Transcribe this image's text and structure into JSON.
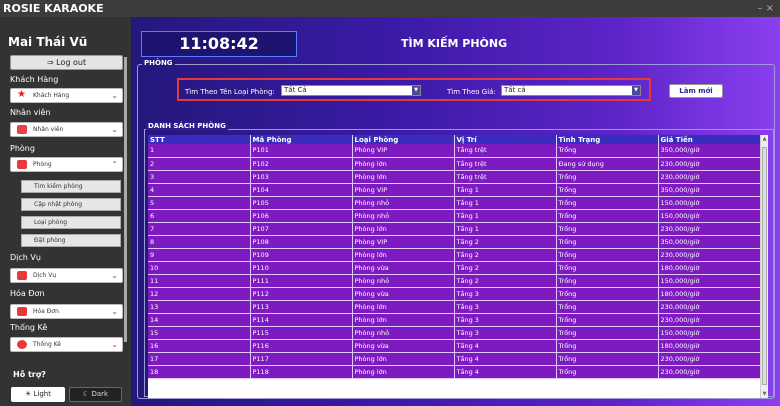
{
  "window": {
    "title": "ROSIE KARAOKE",
    "controls": "–  ×"
  },
  "sidebar": {
    "user_name": "Mai Thái Vũ",
    "logout_label": "Log out",
    "sections": [
      {
        "label": "Khách Hàng",
        "dropdown": "Khách Hàng",
        "icon_color": "#e82323",
        "chev": "⌄"
      },
      {
        "label": "Nhân viên",
        "dropdown": "Nhân viên",
        "icon_color": "#e84343",
        "chev": "⌄"
      },
      {
        "label": "Phòng",
        "dropdown": "Phòng",
        "icon_color": "#e83a3a",
        "chev": "⌃"
      },
      {
        "label": "Dịch Vụ",
        "dropdown": "Dịch Vụ",
        "icon_color": "#e83a3a",
        "chev": "⌄"
      },
      {
        "label": "Hóa Đơn",
        "dropdown": "Hóa Đơn",
        "icon_color": "#e83a3a",
        "chev": "⌄"
      },
      {
        "label": "Thống Kê",
        "dropdown": "Thống Kê",
        "icon_color": "#e83a3a",
        "chev": "⌄"
      }
    ],
    "phong_subitems": [
      "Tìm kiếm phòng",
      "Cập nhật phòng",
      "Loại phòng",
      "Đặt phòng"
    ],
    "help_label": "Hỗ trợ?",
    "theme_light": "Light",
    "theme_dark": "Dark"
  },
  "main": {
    "clock": "11:08:42",
    "title": "TÌM KIẾM PHÒNG",
    "group_label": "PHÒNG",
    "filter": {
      "type_label": "Tìm Theo Tên Loại Phòng:",
      "type_value": "Tất Cả",
      "price_label": "Tìm Theo Giá:",
      "price_value": "Tất cả",
      "refresh_label": "Làm mới"
    },
    "list_label": "DANH SÁCH PHÒNG",
    "columns": [
      "STT",
      "Mã Phòng",
      "Loại Phòng",
      "Vị Trí",
      "Tình Trạng",
      "Giá Tiền"
    ],
    "rows": [
      [
        "1",
        "P101",
        "Phòng VIP",
        "Tầng trệt",
        "Trống",
        "350,000/giờ"
      ],
      [
        "2",
        "P102",
        "Phòng lớn",
        "Tầng trệt",
        "Đang sử dụng",
        "230,000/giờ"
      ],
      [
        "3",
        "P103",
        "Phòng lớn",
        "Tầng trệt",
        "Trống",
        "230,000/giờ"
      ],
      [
        "4",
        "P104",
        "Phòng VIP",
        "Tầng 1",
        "Trống",
        "350,000/giờ"
      ],
      [
        "5",
        "P105",
        "Phòng nhỏ",
        "Tầng 1",
        "Trống",
        "150,000/giờ"
      ],
      [
        "6",
        "P106",
        "Phòng nhỏ",
        "Tầng 1",
        "Trống",
        "150,000/giờ"
      ],
      [
        "7",
        "P107",
        "Phòng lớn",
        "Tầng 1",
        "Trống",
        "230,000/giờ"
      ],
      [
        "8",
        "P108",
        "Phòng VIP",
        "Tầng 2",
        "Trống",
        "350,000/giờ"
      ],
      [
        "9",
        "P109",
        "Phòng lớn",
        "Tầng 2",
        "Trống",
        "230,000/giờ"
      ],
      [
        "10",
        "P110",
        "Phòng vừa",
        "Tầng 2",
        "Trống",
        "180,000/giờ"
      ],
      [
        "11",
        "P111",
        "Phòng nhỏ",
        "Tầng 2",
        "Trống",
        "150,000/giờ"
      ],
      [
        "12",
        "P112",
        "Phòng vừa",
        "Tầng 3",
        "Trống",
        "180,000/giờ"
      ],
      [
        "13",
        "P113",
        "Phòng lớn",
        "Tầng 3",
        "Trống",
        "230,000/giờ"
      ],
      [
        "14",
        "P114",
        "Phòng lớn",
        "Tầng 3",
        "Trống",
        "230,000/giờ"
      ],
      [
        "15",
        "P115",
        "Phòng nhỏ",
        "Tầng 3",
        "Trống",
        "150,000/giờ"
      ],
      [
        "16",
        "P116",
        "Phòng vừa",
        "Tầng 4",
        "Trống",
        "180,000/giờ"
      ],
      [
        "17",
        "P117",
        "Phòng lớn",
        "Tầng 4",
        "Trống",
        "230,000/giờ"
      ],
      [
        "18",
        "P118",
        "Phòng lớn",
        "Tầng 4",
        "Trống",
        "230,000/giờ"
      ]
    ]
  }
}
